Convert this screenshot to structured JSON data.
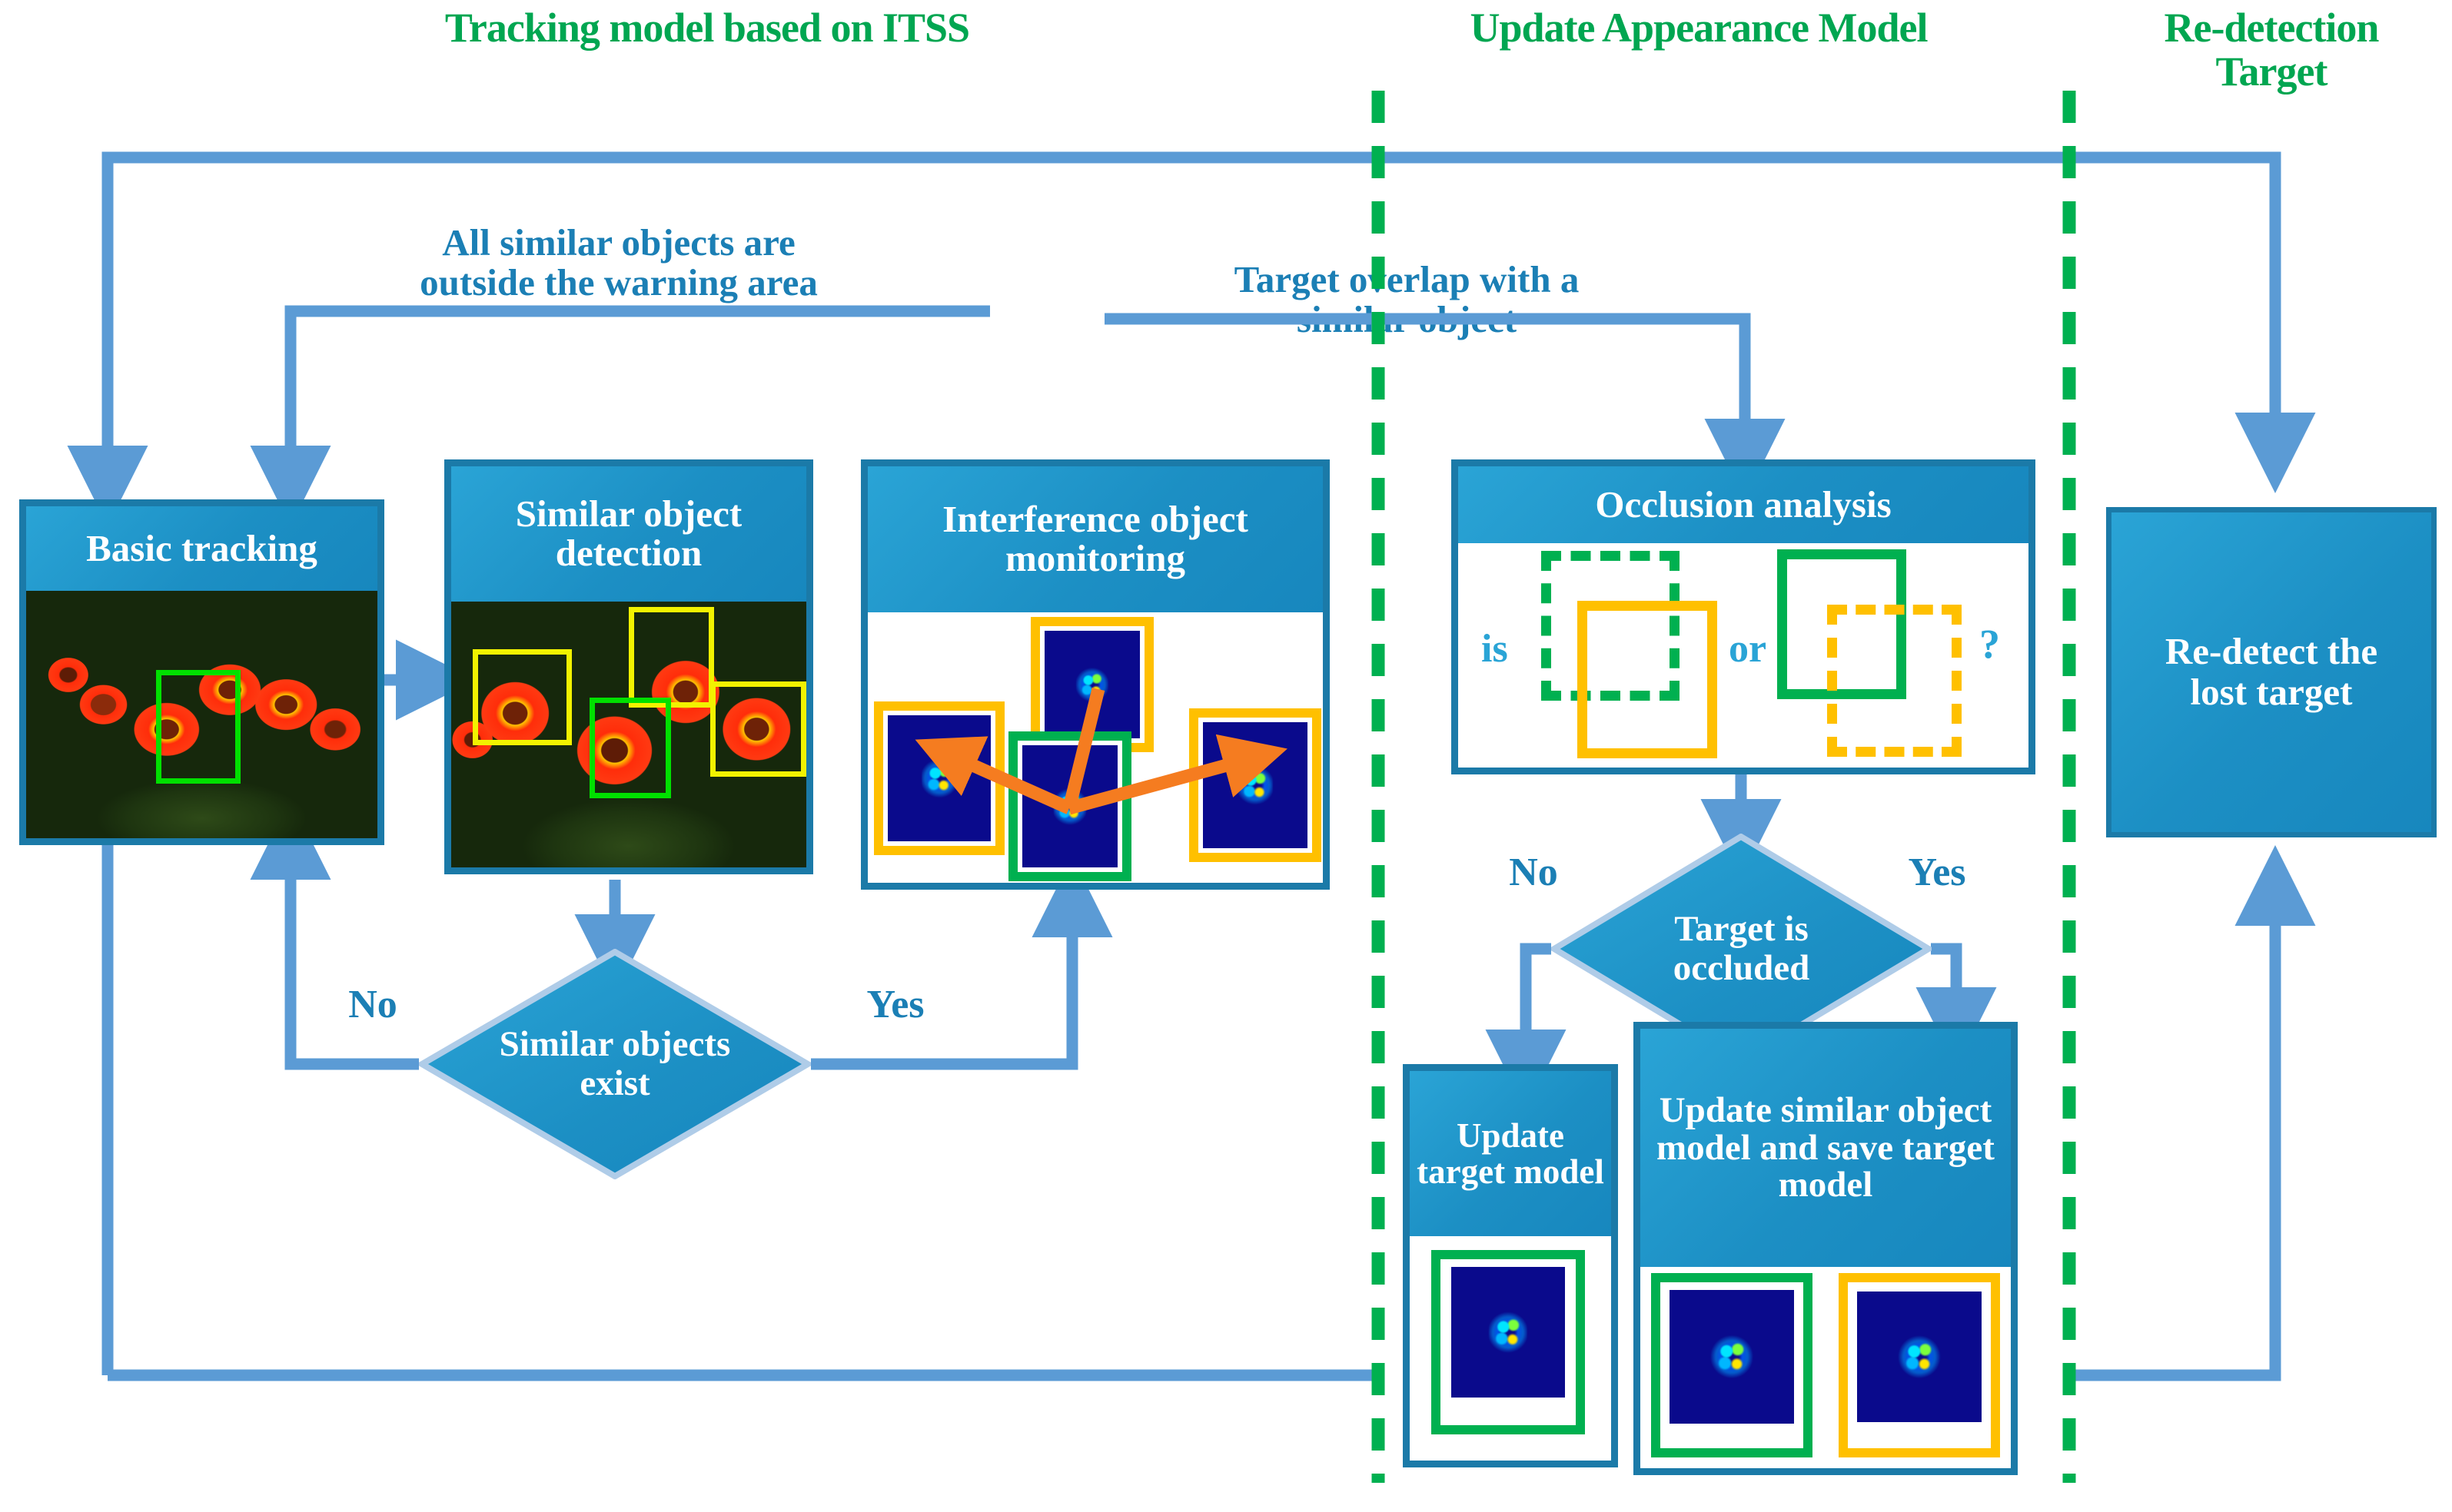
{
  "sections": [
    {
      "id": "tracking",
      "title": "Tracking model based on ITSS"
    },
    {
      "id": "update",
      "title": "Update Appearance Model"
    },
    {
      "id": "redetect",
      "title": "Re-detection Target"
    }
  ],
  "boxes": {
    "basic_tracking": "Basic tracking",
    "similar_object_detection": "Similar object detection",
    "interference_object_monitoring": "Interference object monitoring",
    "occlusion_analysis": "Occlusion analysis",
    "redetect_lost_target": "Re-detect the lost target",
    "update_target_model": "Update target model",
    "update_similar_object_model": "Update similar object model and save target model"
  },
  "decisions": {
    "similar_objects_exist": "Similar objects exist",
    "target_is_occluded": "Target is occluded"
  },
  "edge_labels": {
    "similar_no": "No",
    "similar_yes": "Yes",
    "occluded_no": "No",
    "occluded_yes": "Yes",
    "all_similar_outside": "All similar objects are outside the warning area",
    "target_overlap": "Target overlap with a similar object"
  },
  "occlusion_panel": {
    "is_label": "is",
    "or_label": "or",
    "question_label": "?"
  },
  "colors": {
    "section_title": "#00A651",
    "box_fill": "#1C8FC4",
    "box_border": "#1B7AA8",
    "connector": "#5B9BD5",
    "label_text": "#1B7FB5",
    "divider": "#00B050",
    "target_box": "#00B050",
    "similar_box": "#FFC000",
    "detect_box": "#FFD400",
    "motion_arrow": "#F57C20",
    "map_bg": "#0A0A8C"
  }
}
